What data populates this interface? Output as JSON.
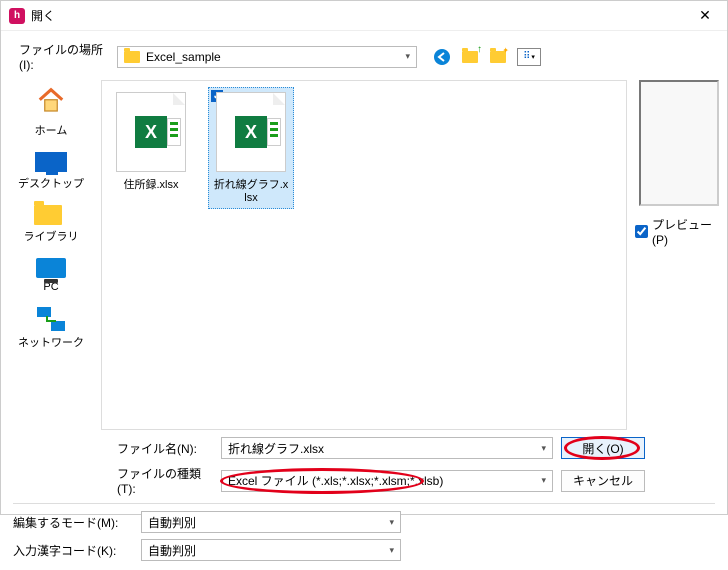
{
  "title": "開く",
  "location": {
    "label": "ファイルの場所(I):",
    "value": "Excel_sample"
  },
  "sidebar": {
    "items": [
      {
        "label": "ホーム"
      },
      {
        "label": "デスクトップ"
      },
      {
        "label": "ライブラリ"
      },
      {
        "label": "PC"
      },
      {
        "label": "ネットワーク"
      }
    ]
  },
  "files": [
    {
      "name": "住所録.xlsx",
      "selected": false
    },
    {
      "name": "折れ線グラフ.xlsx",
      "selected": true
    }
  ],
  "preview": {
    "label": "プレビュー(P)",
    "checked": true
  },
  "filename": {
    "label": "ファイル名(N):",
    "value": "折れ線グラフ.xlsx"
  },
  "filetype": {
    "label": "ファイルの種類(T):",
    "value": "Excel ファイル (*.xls;*.xlsx;*.xlsm;*.xlsb)"
  },
  "buttons": {
    "open": "開く(O)",
    "cancel": "キャンセル"
  },
  "edit_mode": {
    "label": "編集するモード(M):",
    "value": "自動判別"
  },
  "encoding": {
    "label": "入力漢字コード(K):",
    "value": "自動判別"
  }
}
